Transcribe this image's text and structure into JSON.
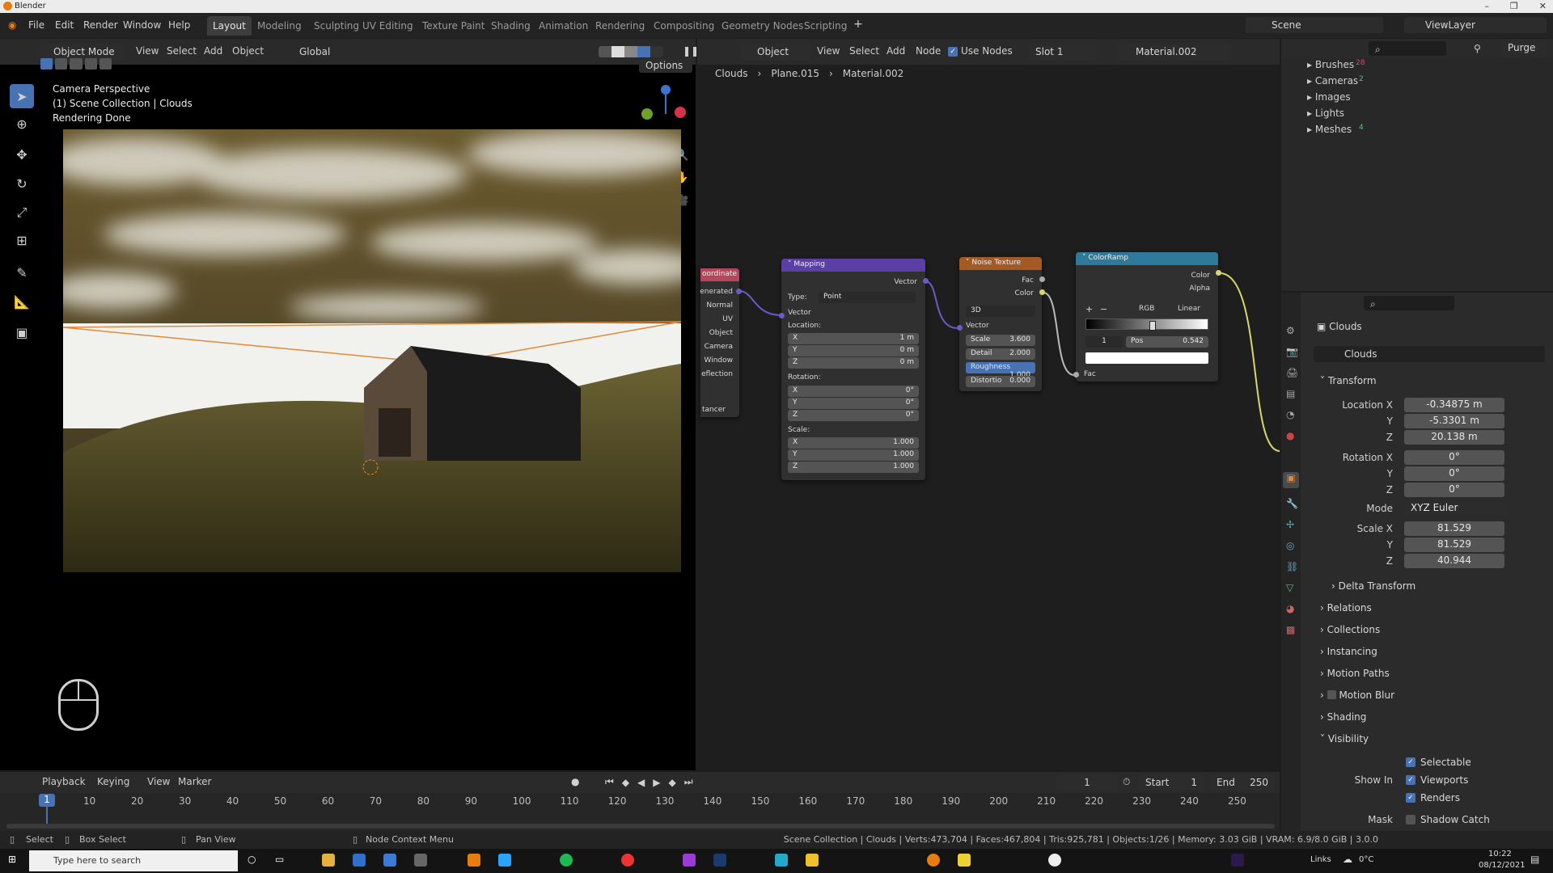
{
  "window": {
    "title": "Blender"
  },
  "menu": [
    "File",
    "Edit",
    "Render",
    "Window",
    "Help"
  ],
  "workspaces": [
    "Layout",
    "Modeling",
    "Sculpting",
    "UV Editing",
    "Texture Paint",
    "Shading",
    "Animation",
    "Rendering",
    "Compositing",
    "Geometry Nodes",
    "Scripting"
  ],
  "active_workspace": "Layout",
  "scene": {
    "name": "Scene",
    "view_layer": "ViewLayer"
  },
  "viewport": {
    "mode": "Object Mode",
    "menus": [
      "View",
      "Select",
      "Add",
      "Object"
    ],
    "transform": "Global",
    "options": "Options",
    "info": [
      "Camera Perspective",
      "(1) Scene Collection | Clouds",
      "Rendering Done"
    ]
  },
  "node_editor": {
    "type": "Object",
    "menus": [
      "View",
      "Select",
      "Add",
      "Node"
    ],
    "use_nodes": "Use Nodes",
    "slot": "Slot 1",
    "material": "Material.002",
    "breadcrumb": [
      "Clouds",
      "Plane.015",
      "Material.002"
    ],
    "texcoord": {
      "title": "oordinate",
      "outputs": [
        "enerated",
        "Normal",
        "UV",
        "Object",
        "Camera",
        "Window",
        "eflection"
      ],
      "footer": "tancer"
    },
    "mapping": {
      "title": "Mapping",
      "out": "Vector",
      "type_label": "Type:",
      "type_value": "Point",
      "vector": "Vector",
      "location": "Location:",
      "rotation": "Rotation:",
      "scale": "Scale:",
      "loc": [
        {
          "axis": "X",
          "value": "1 m"
        },
        {
          "axis": "Y",
          "value": "0 m"
        },
        {
          "axis": "Z",
          "value": "0 m"
        }
      ],
      "rot": [
        {
          "axis": "X",
          "value": "0°"
        },
        {
          "axis": "Y",
          "value": "0°"
        },
        {
          "axis": "Z",
          "value": "0°"
        }
      ],
      "scl": [
        {
          "axis": "X",
          "value": "1.000"
        },
        {
          "axis": "Y",
          "value": "1.000"
        },
        {
          "axis": "Z",
          "value": "1.000"
        }
      ]
    },
    "noise": {
      "title": "Noise Texture",
      "fac": "Fac",
      "color": "Color",
      "dim": "3D",
      "vector": "Vector",
      "fields": [
        {
          "label": "Scale",
          "value": "3.600"
        },
        {
          "label": "Detail",
          "value": "2.000"
        },
        {
          "label": "Roughness",
          "value": "1.000"
        },
        {
          "label": "Distortio",
          "value": "0.000"
        }
      ]
    },
    "colorramp": {
      "title": "ColorRamp",
      "color": "Color",
      "alpha": "Alpha",
      "mode": "RGB",
      "interp": "Linear",
      "index": "1",
      "pos_label": "Pos",
      "pos_value": "0.542",
      "fac": "Fac",
      "stop_pos": 0.542
    }
  },
  "outliner": {
    "items": [
      "Brushes",
      "Cameras",
      "Images",
      "Lights",
      "Meshes"
    ],
    "counts": [
      "28",
      "2",
      "",
      "",
      "4"
    ],
    "purge": "Purge"
  },
  "properties": {
    "object": "Clouds",
    "data": "Clouds",
    "transform": "Transform",
    "location": [
      {
        "label": "Location X",
        "value": "-0.34875 m"
      },
      {
        "label": "Y",
        "value": "-5.3301 m"
      },
      {
        "label": "Z",
        "value": "20.138 m"
      }
    ],
    "rotation": [
      {
        "label": "Rotation X",
        "value": "0°"
      },
      {
        "label": "Y",
        "value": "0°"
      },
      {
        "label": "Z",
        "value": "0°"
      }
    ],
    "mode_label": "Mode",
    "mode_value": "XYZ Euler",
    "scale": [
      {
        "label": "Scale X",
        "value": "81.529"
      },
      {
        "label": "Y",
        "value": "81.529"
      },
      {
        "label": "Z",
        "value": "40.944"
      }
    ],
    "sections": [
      "Delta Transform",
      "Relations",
      "Collections",
      "Instancing",
      "Motion Paths",
      "Motion Blur",
      "Shading",
      "Visibility"
    ],
    "visibility": {
      "selectable": "Selectable",
      "show_in": "Show In",
      "viewports": "Viewports",
      "renders": "Renders",
      "mask": "Mask",
      "shadow": "Shadow Catch"
    }
  },
  "timeline": {
    "menus": [
      "Playback",
      "Keying",
      "View",
      "Marker"
    ],
    "current": "1",
    "start_label": "Start",
    "start": "1",
    "end_label": "End",
    "end": "250",
    "ticks": [
      "10",
      "20",
      "30",
      "40",
      "50",
      "60",
      "70",
      "80",
      "90",
      "100",
      "110",
      "120",
      "130",
      "140",
      "150",
      "160",
      "170",
      "180",
      "190",
      "200",
      "210",
      "220",
      "230",
      "240",
      "250"
    ],
    "frame_marker": "1"
  },
  "status": {
    "select": "Select",
    "box_select": "Box Select",
    "pan": "Pan View",
    "context": "Node Context Menu",
    "stats": "Scene Collection | Clouds | Verts:473,704 | Faces:467,804 | Tris:925,781 | Objects:1/26 | Memory: 3.03 GiB | VRAM: 6.9/8.0 GiB | 3.0.0"
  },
  "taskbar": {
    "search": "Type here to search",
    "links": "Links",
    "temp": "0°C",
    "time": "10:22",
    "date": "08/12/2021"
  }
}
